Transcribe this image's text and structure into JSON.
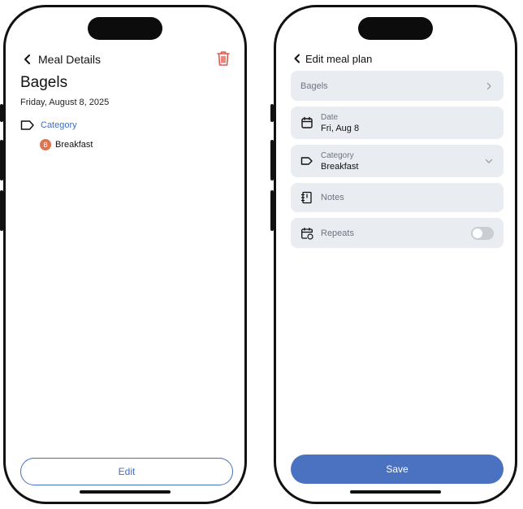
{
  "details_screen": {
    "nav_title": "Meal Details",
    "meal_name": "Bagels",
    "date": "Friday, August 8, 2025",
    "category_label": "Category",
    "category_badge": "B",
    "category_value": "Breakfast",
    "edit_label": "Edit",
    "icons": {
      "back": "chevron-left-icon",
      "delete": "trash-icon",
      "category": "tag-icon"
    },
    "colors": {
      "accent": "#3f6fbf",
      "delete": "#e0554a",
      "badge": "#e07350"
    }
  },
  "edit_screen": {
    "nav_title": "Edit meal plan",
    "meal_field": "Bagels",
    "date_label": "Date",
    "date_value": "Fri, Aug 8",
    "category_label": "Category",
    "category_value": "Breakfast",
    "notes_placeholder": "Notes",
    "repeats_label": "Repeats",
    "repeats_on": false,
    "save_label": "Save",
    "icons": {
      "back": "chevron-left-icon",
      "meal": "chevron-right-icon",
      "date": "calendar-icon",
      "category": "tag-icon",
      "category_trail": "chevron-down-icon",
      "notes": "notebook-icon",
      "repeats": "calendar-repeat-icon"
    },
    "colors": {
      "field_bg": "#e9ecf1",
      "save_bg": "#4a72c0"
    }
  }
}
